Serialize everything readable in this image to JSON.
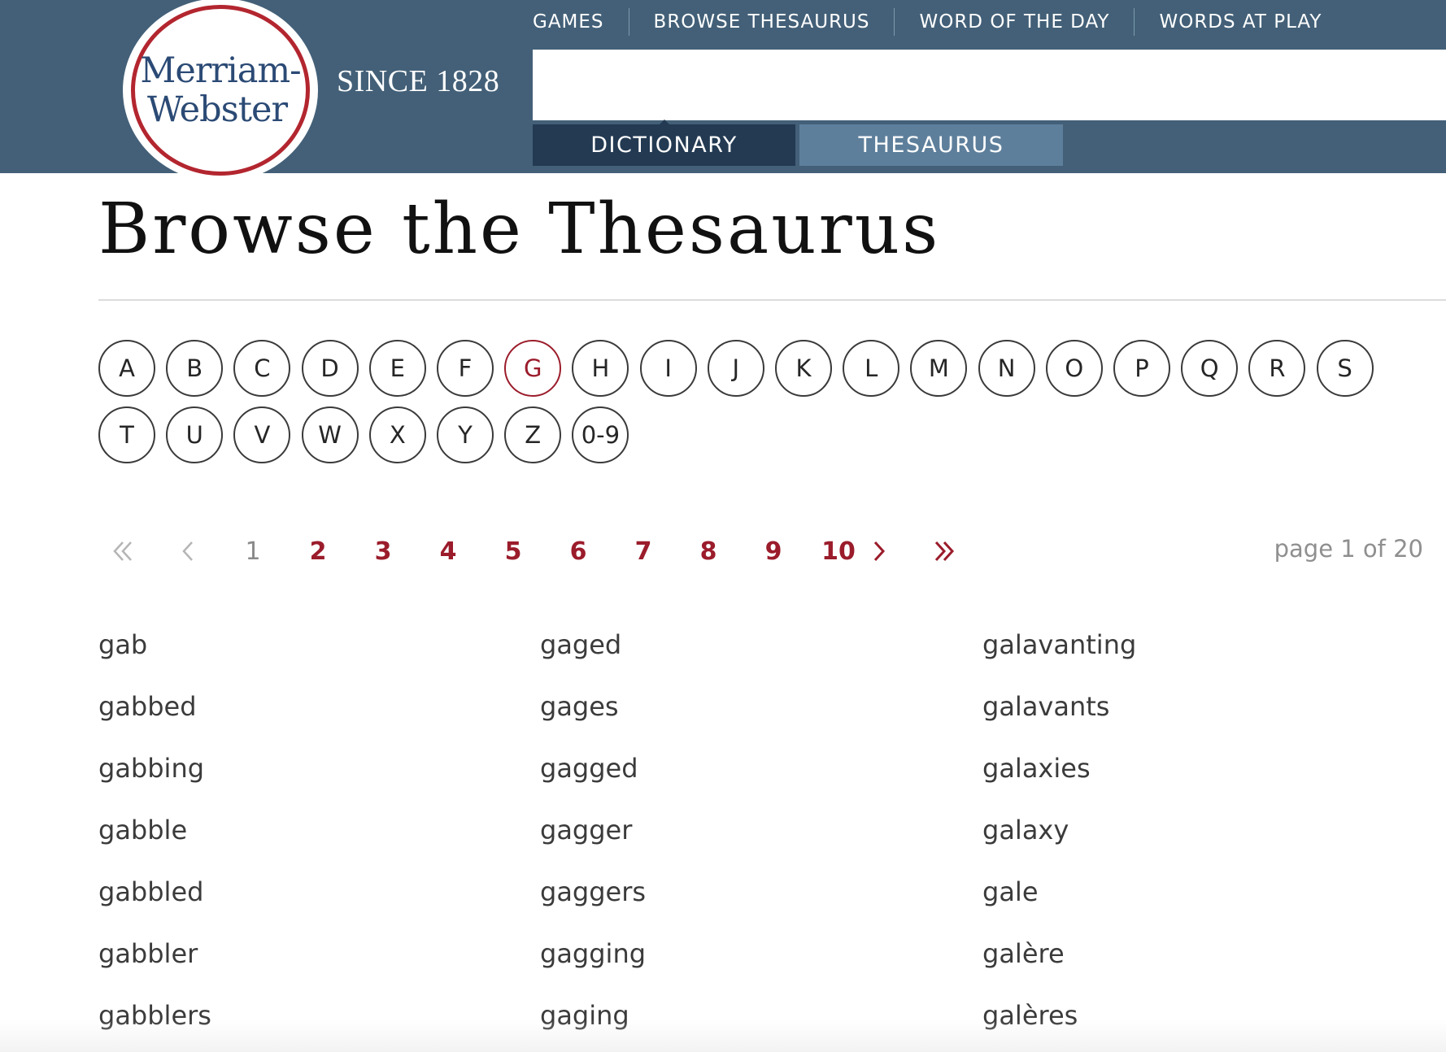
{
  "header": {
    "logo": {
      "line1": "Merriam-",
      "line2": "Webster"
    },
    "since": "SINCE 1828",
    "nav": [
      "GAMES",
      "BROWSE THESAURUS",
      "WORD OF THE DAY",
      "WORDS AT PLAY"
    ],
    "search": {
      "value": "",
      "placeholder": ""
    },
    "tabs": {
      "dictionary": "DICTIONARY",
      "thesaurus": "THESAURUS"
    }
  },
  "main": {
    "title": "Browse the Thesaurus",
    "letters": [
      "A",
      "B",
      "C",
      "D",
      "E",
      "F",
      "G",
      "H",
      "I",
      "J",
      "K",
      "L",
      "M",
      "N",
      "O",
      "P",
      "Q",
      "R",
      "S",
      "T",
      "U",
      "V",
      "W",
      "X",
      "Y",
      "Z",
      "0-9"
    ],
    "active_letter": "G",
    "pagination": {
      "pages": [
        "1",
        "2",
        "3",
        "4",
        "5",
        "6",
        "7",
        "8",
        "9",
        "10"
      ],
      "current_page": "1",
      "page_count": "page 1 of 20"
    },
    "words": {
      "col1": [
        "gab",
        "gabbed",
        "gabbing",
        "gabble",
        "gabbled",
        "gabbler",
        "gabblers"
      ],
      "col2": [
        "gaged",
        "gages",
        "gagged",
        "gagger",
        "gaggers",
        "gagging",
        "gaging"
      ],
      "col3": [
        "galavanting",
        "galavants",
        "galaxies",
        "galaxy",
        "gale",
        "galère",
        "galères"
      ]
    }
  },
  "colors": {
    "header_bg": "#436078",
    "dictionary_tab": "#233a52",
    "thesaurus_tab": "#5e7f9b",
    "accent_red": "#9b1c2b",
    "logo_ring": "#b3262f",
    "logo_text": "#2b4a75"
  },
  "icons": {
    "first": "double-chevron-left-icon",
    "prev": "chevron-left-icon",
    "next": "chevron-right-icon",
    "last": "double-chevron-right-icon"
  }
}
